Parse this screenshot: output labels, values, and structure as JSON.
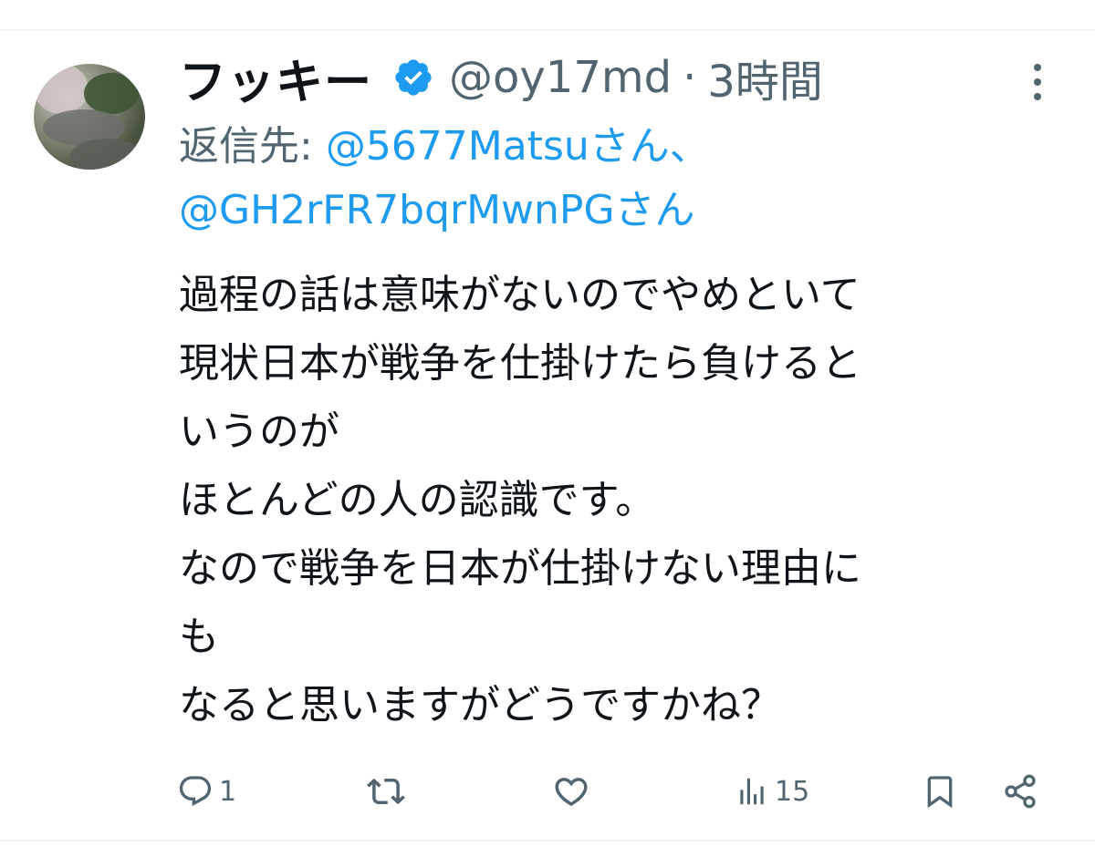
{
  "tweet": {
    "display_name": "フッキー",
    "handle": "@oy17md",
    "separator": "·",
    "time": "3時間",
    "reply_prefix": "返信先: ",
    "reply_mentions": [
      "@5677Matsuさん、",
      "@GH2rFR7bqrMwnPGさん"
    ],
    "body_lines": [
      "過程の話は意味がないのでやめといて",
      "現状日本が戦争を仕掛けたら負けると",
      "いうのが",
      "ほとんどの人の認識です。",
      "なので戦争を日本が仕掛けない理由に",
      "も",
      "なると思いますがどうですかね？"
    ],
    "actions": {
      "reply_count": "1",
      "retweet_count": "",
      "like_count": "",
      "views_count": "15"
    }
  },
  "icons": {
    "verified": "verified-badge-icon",
    "more": "more-vertical-icon",
    "reply": "reply-icon",
    "retweet": "retweet-icon",
    "like": "heart-icon",
    "views": "views-icon",
    "bookmark": "bookmark-icon",
    "share": "share-icon"
  },
  "colors": {
    "accent": "#1d9bf0",
    "text_primary": "#0f1419",
    "text_secondary": "#536471",
    "divider": "#eff3f4"
  }
}
